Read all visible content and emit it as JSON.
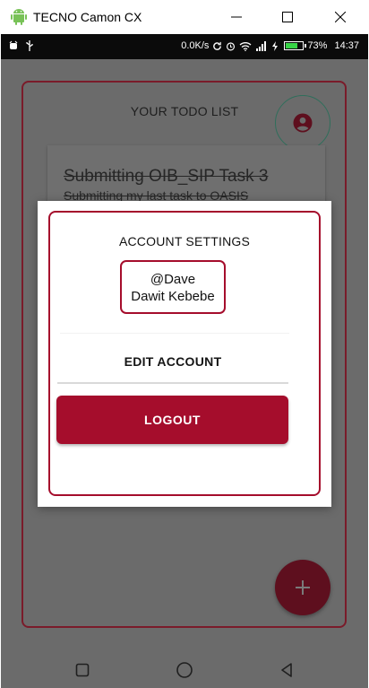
{
  "window": {
    "title": "TECNO Camon CX"
  },
  "statusbar": {
    "speed": "0.0K/s",
    "battery_percent": "73%",
    "battery_level": 0.73,
    "time": "14:37"
  },
  "app": {
    "title": "YOUR TODO LIST",
    "todos": [
      {
        "title": "Submitting OIB_SIP Task 3",
        "description": "Submitting my last task to OASIS"
      }
    ]
  },
  "dialog": {
    "title": "ACCOUNT SETTINGS",
    "username": "@Dave",
    "full_name": "Dawit Kebebe",
    "edit_label": "EDIT ACCOUNT",
    "logout_label": "LOGOUT"
  },
  "colors": {
    "accent": "#a50d2c",
    "scrim": "#6b6b6b"
  }
}
